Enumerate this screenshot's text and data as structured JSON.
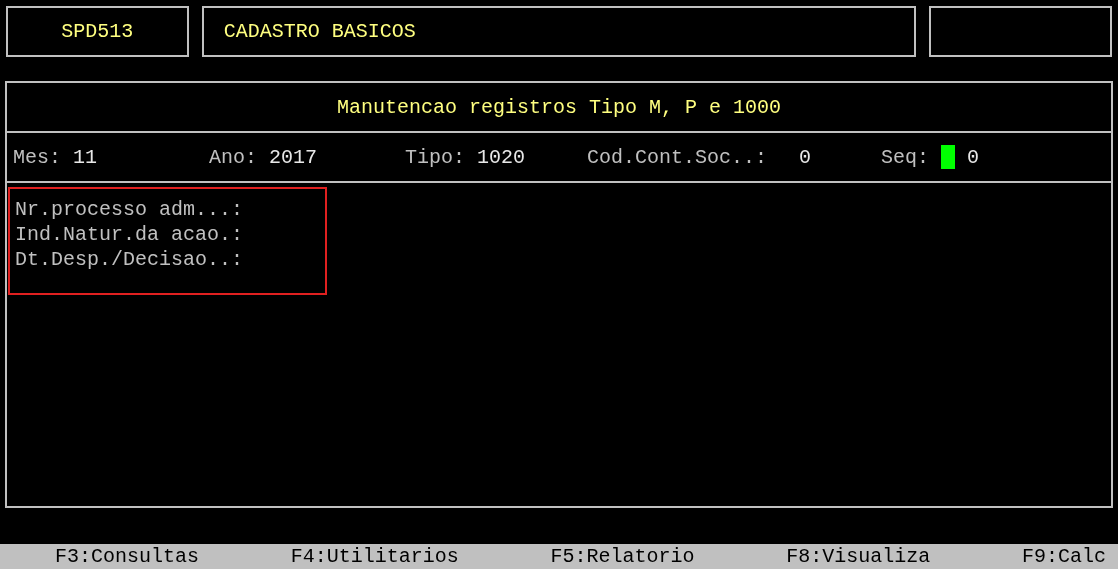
{
  "header": {
    "program_code": "SPD513",
    "screen_title": "CADASTRO BASICOS"
  },
  "panel": {
    "title": "Manutencao registros Tipo M, P e 1000",
    "fields": [
      {
        "label": "Mes:",
        "value": "11",
        "cursor": false
      },
      {
        "label": "Ano:",
        "value": "2017",
        "cursor": false
      },
      {
        "label": "Tipo:",
        "value": "1020",
        "cursor": false
      },
      {
        "label": "Cod.Cont.Soc..:",
        "value": "0",
        "cursor": false
      },
      {
        "label": "Seq:",
        "value": "0",
        "cursor": true
      }
    ],
    "form_lines": [
      "Nr.processo adm...:",
      "Ind.Natur.da acao.:",
      "Dt.Desp./Decisao..:"
    ]
  },
  "function_keys": [
    "F3:Consultas",
    "F4:Utilitarios",
    "F5:Relatorio",
    "F8:Visualiza",
    "F9:Calc"
  ]
}
